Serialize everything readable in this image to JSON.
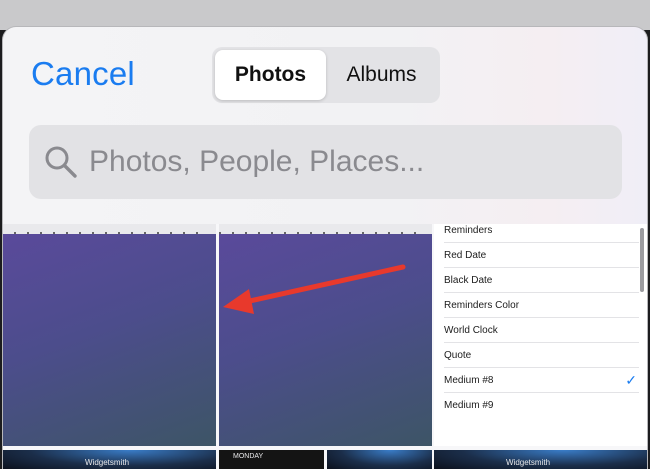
{
  "header": {
    "cancel_label": "Cancel",
    "tabs": [
      {
        "label": "Photos",
        "active": true
      },
      {
        "label": "Albums",
        "active": false
      }
    ]
  },
  "search": {
    "placeholder": "Photos, People, Places..."
  },
  "widget_list": {
    "items": [
      {
        "label": "Reminders",
        "checked": false
      },
      {
        "label": "Red Date",
        "checked": false
      },
      {
        "label": "Black Date",
        "checked": false
      },
      {
        "label": "Reminders Color",
        "checked": false
      },
      {
        "label": "World Clock",
        "checked": false
      },
      {
        "label": "Quote",
        "checked": false
      },
      {
        "label": "Medium #8",
        "checked": true
      },
      {
        "label": "Medium #9",
        "checked": false
      }
    ],
    "check_glyph": "✓"
  },
  "bottom_row": {
    "tile1_text": "Widgetsmith",
    "tile2_day": "MONDAY",
    "tile4_text": "Widgetsmith"
  },
  "colors": {
    "accent": "#1a7cf0",
    "arrow": "#e8392c"
  },
  "icons": [
    "search-icon",
    "checkmark-icon",
    "red-arrow-annotation"
  ]
}
